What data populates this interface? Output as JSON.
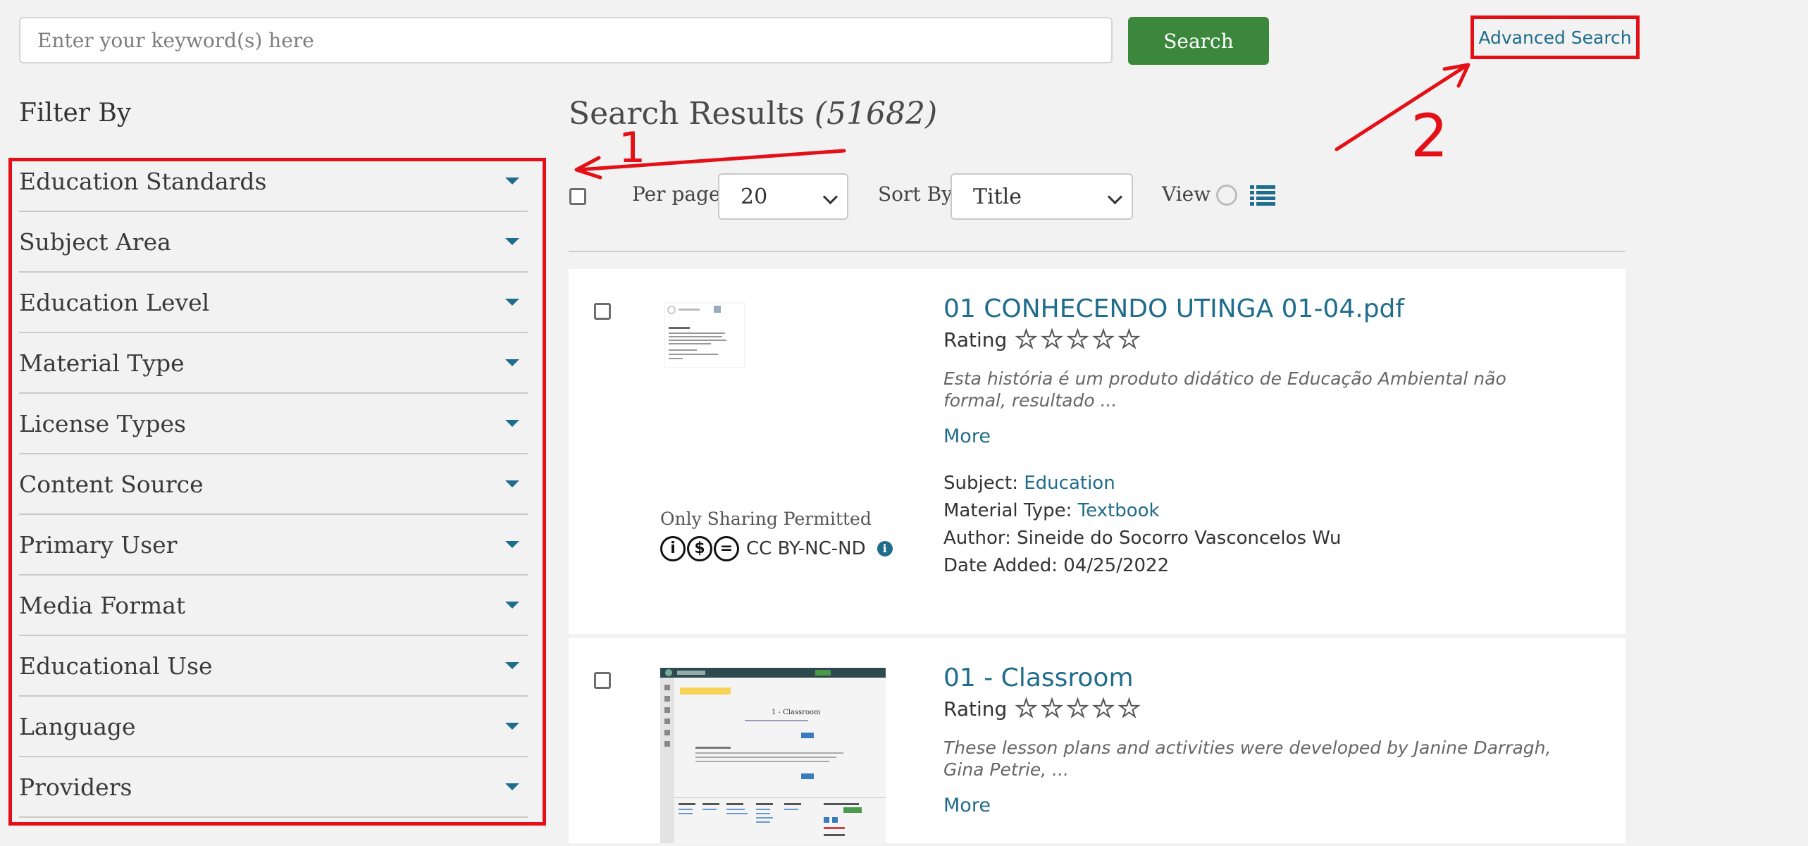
{
  "search": {
    "placeholder": "Enter your keyword(s) here",
    "button_label": "Search",
    "advanced_label": "Advanced Search"
  },
  "filters": {
    "title": "Filter By",
    "items": [
      "Education Standards",
      "Subject Area",
      "Education Level",
      "Material Type",
      "License Types",
      "Content Source",
      "Primary User",
      "Media Format",
      "Educational Use",
      "Language",
      "Providers"
    ]
  },
  "results": {
    "title": "Search Results",
    "count": "(51682)",
    "per_page_label": "Per page",
    "per_page_value": "20",
    "sort_label": "Sort By",
    "sort_value": "Title",
    "view_label": "View"
  },
  "annotations": {
    "one": "1",
    "two": "2",
    "color": "#e40f17"
  },
  "items": [
    {
      "title": "01 CONHECENDO UTINGA 01-04.pdf",
      "rating_label": "Rating",
      "rating_stars": 0,
      "description": "Esta história é um produto didático de Educação Ambiental não formal, resultado ...",
      "more_label": "More",
      "subject_label": "Subject:",
      "subject_value": "Education",
      "material_label": "Material Type:",
      "material_value": "Textbook",
      "author": "Author: Sineide do Socorro Vasconcelos Wu",
      "date": "Date Added: 04/25/2022",
      "license_note": "Only Sharing Permitted",
      "license_name": "CC BY-NC-ND"
    },
    {
      "title": "01 - Classroom",
      "rating_label": "Rating",
      "rating_stars": 0,
      "description": "These lesson plans and activities were developed by Janine Darragh, Gina Petrie, ...",
      "more_label": "More",
      "thumb_heading": "1 - Classroom"
    }
  ],
  "colors": {
    "accent": "#1f6c8c",
    "search_button": "#3b873c",
    "highlight": "#e40f17"
  }
}
